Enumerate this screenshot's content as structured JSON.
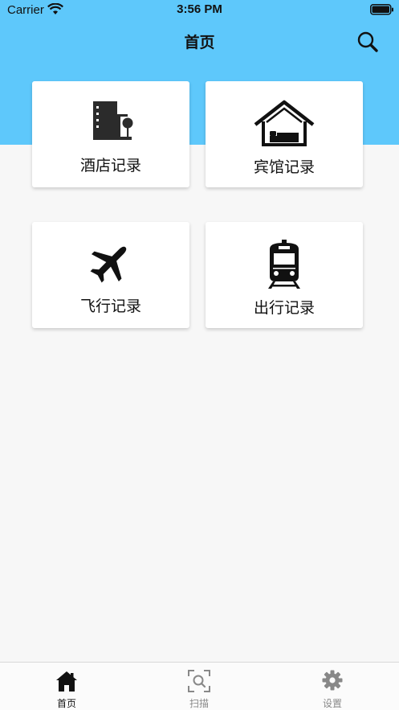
{
  "status_bar": {
    "carrier": "Carrier",
    "time": "3:56 PM"
  },
  "nav": {
    "title": "首页",
    "search_icon": "search-icon"
  },
  "cards": [
    {
      "label": "酒店记录",
      "icon": "hotel-building-icon"
    },
    {
      "label": "宾馆记录",
      "icon": "house-bed-icon"
    },
    {
      "label": "飞行记录",
      "icon": "airplane-icon"
    },
    {
      "label": "出行记录",
      "icon": "train-icon"
    }
  ],
  "tabbar": {
    "items": [
      {
        "label": "首页",
        "icon": "home-icon",
        "active": true
      },
      {
        "label": "扫描",
        "icon": "scan-icon",
        "active": false
      },
      {
        "label": "设置",
        "icon": "gear-icon",
        "active": false
      }
    ]
  },
  "colors": {
    "header": "#5ec8fb",
    "background": "#f7f7f7",
    "active_tab": "#111111",
    "inactive_tab": "#888888"
  }
}
